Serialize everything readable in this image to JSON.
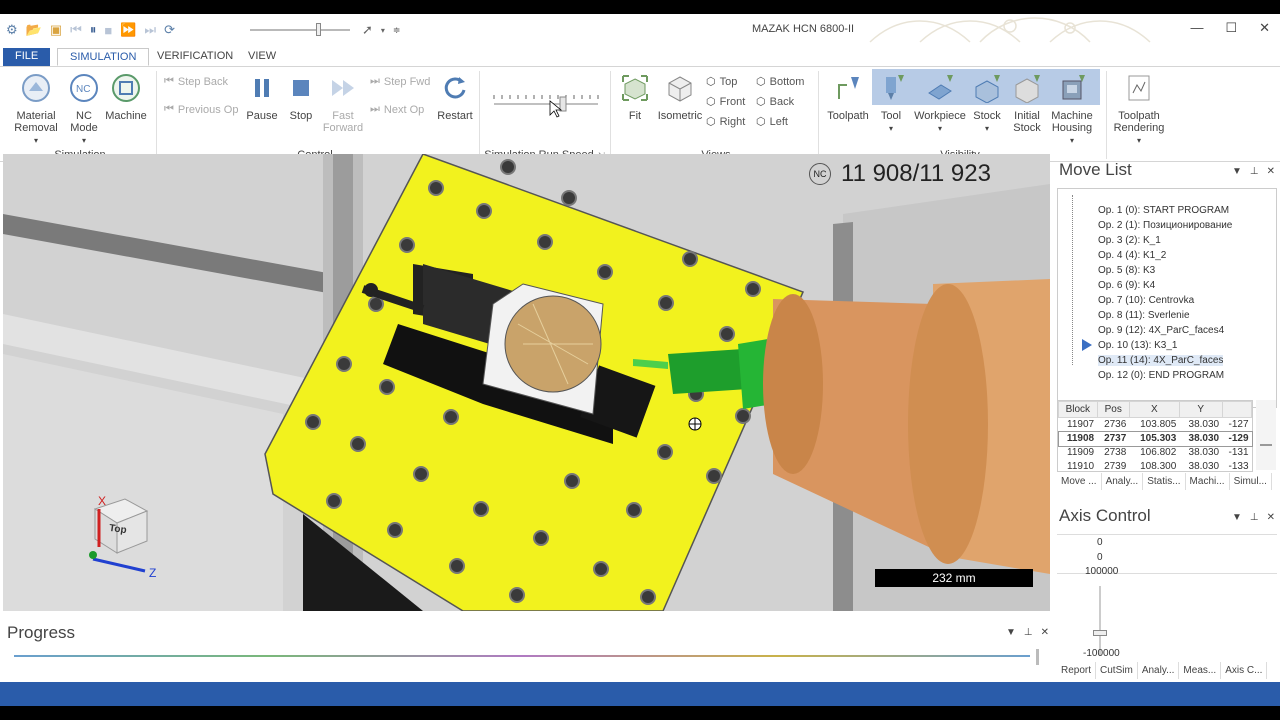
{
  "title": "MAZAK HCN 6800-II",
  "ribbon_tabs": [
    "FILE",
    "SIMULATION",
    "VERIFICATION",
    "VIEW"
  ],
  "simulation_group": {
    "label": "Simulation",
    "material_removal": "Material Removal",
    "nc_mode": "NC Mode",
    "machine": "Machine"
  },
  "control_group": {
    "label": "Control",
    "step_back": "Step Back",
    "previous_op": "Previous Op",
    "pause": "Pause",
    "stop": "Stop",
    "fast_forward": "Fast Forward",
    "step_fwd": "Step Fwd",
    "next_op": "Next Op",
    "restart": "Restart"
  },
  "speed_group": {
    "label": "Simulation Run Speed"
  },
  "views_group": {
    "label": "Views",
    "fit": "Fit",
    "isometric": "Isometric",
    "top": "Top",
    "bottom": "Bottom",
    "front": "Front",
    "back": "Back",
    "right": "Right",
    "left": "Left"
  },
  "visibility_group": {
    "label": "Visibility",
    "toolpath": "Toolpath",
    "tool": "Tool",
    "workpiece": "Workpiece",
    "stock": "Stock",
    "initial_stock": "Initial Stock",
    "machine_housing": "Machine Housing",
    "toolpath_rendering": "Toolpath Rendering"
  },
  "viewport": {
    "nc_counter": "11 908/11 923",
    "scale_label": "232 mm",
    "cube_face": "Top",
    "axis_x": "X",
    "axis_z": "Z"
  },
  "move_list": {
    "title": "Move List",
    "items": [
      "Op. 1 (0): START PROGRAM",
      "Op. 2 (1): Позиционирование",
      "Op. 3 (2): K_1",
      "Op. 4 (4): K1_2",
      "Op. 5 (8): K3",
      "Op. 6 (9): K4",
      "Op. 7 (10): Centrovka",
      "Op. 8 (11): Sverlenie",
      "Op. 9 (12): 4X_ParC_faces4",
      "Op. 10 (13): K3_1",
      "Op. 11 (14): 4X_ParC_faces",
      "Op. 12 (0): END PROGRAM"
    ],
    "selected_index": 10
  },
  "block_table": {
    "headers": [
      "Block",
      "Pos",
      "X",
      "Y",
      ""
    ],
    "rows": [
      [
        "11907",
        "2736",
        "103.805",
        "38.030",
        "-127"
      ],
      [
        "11908",
        "2737",
        "105.303",
        "38.030",
        "-129"
      ],
      [
        "11909",
        "2738",
        "106.802",
        "38.030",
        "-131"
      ],
      [
        "11910",
        "2739",
        "108.300",
        "38.030",
        "-133"
      ]
    ],
    "current_row": 1
  },
  "move_tabs": [
    "Move ...",
    "Analy...",
    "Statis...",
    "Machi...",
    "Simul..."
  ],
  "axis_control": {
    "title": "Axis Control",
    "value_top": "0",
    "value_mid": "0",
    "value_max": "100000",
    "value_min": "-100000"
  },
  "bottom_tabs": [
    "Report",
    "CutSim",
    "Analy...",
    "Meas...",
    "Axis C..."
  ],
  "progress": {
    "title": "Progress",
    "value": 0.99
  }
}
